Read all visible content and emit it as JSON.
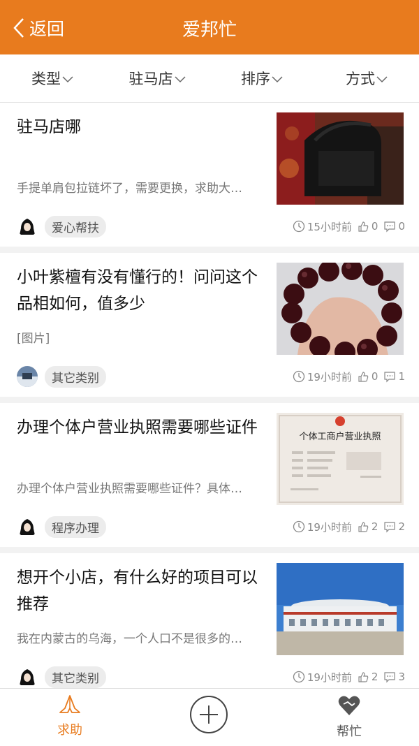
{
  "header": {
    "back_label": "返回",
    "title": "爱邦忙"
  },
  "filters": [
    {
      "label": "类型"
    },
    {
      "label": "驻马店"
    },
    {
      "label": "排序"
    },
    {
      "label": "方式"
    }
  ],
  "items": [
    {
      "title": "驻马店哪",
      "desc": "手提单肩包拉链坏了，需要更换，求助大…",
      "tag": "爱心帮扶",
      "time": "15小时前",
      "likes": "0",
      "comments": "0",
      "thumb": "black-bag-photo"
    },
    {
      "title": "小叶紫檀有没有懂行的！问问这个品相如何，值多少",
      "desc": "[图片]",
      "tag": "其它类别",
      "time": "19小时前",
      "likes": "0",
      "comments": "1",
      "thumb": "bead-bracelet-photo"
    },
    {
      "title": "办理个体户营业执照需要哪些证件",
      "desc": "办理个体户营业执照需要哪些证件？具体…",
      "tag": "程序办理",
      "time": "19小时前",
      "likes": "2",
      "comments": "2",
      "thumb": "business-license-photo",
      "thumb_text": "个体工商户营业执照"
    },
    {
      "title": "想开个小店，有什么好的项目可以推荐",
      "desc": "我在内蒙古的乌海，一个人口不是很多的…",
      "tag": "其它类别",
      "time": "19小时前",
      "likes": "2",
      "comments": "3",
      "thumb": "building-photo"
    }
  ],
  "tabbar": {
    "left_label": "求助",
    "right_label": "帮忙",
    "active_color": "#e87b1e"
  },
  "colors": {
    "accent": "#e87b1e"
  }
}
